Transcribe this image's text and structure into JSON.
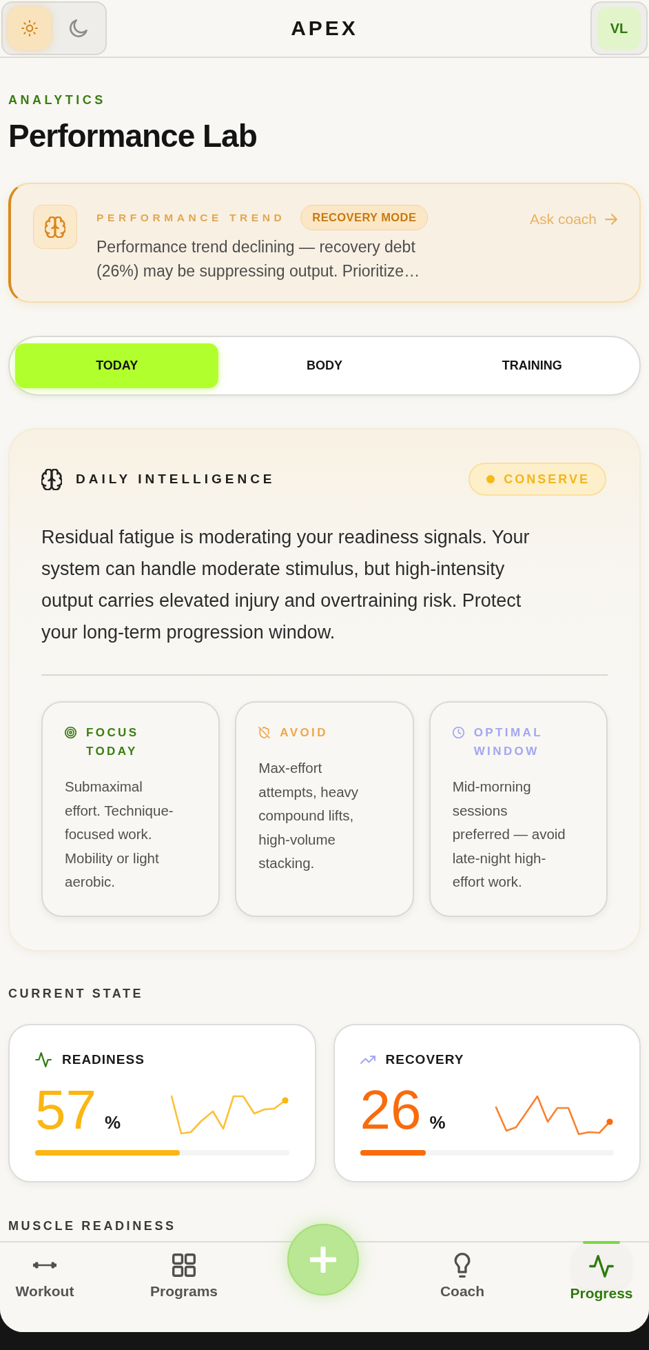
{
  "header": {
    "theme_options": [
      {
        "selected": true
      },
      {
        "selected": false
      }
    ],
    "title": "APEX",
    "avatar": "VL"
  },
  "page": {
    "eyebrow": "ANALYTICS",
    "title": "Performance Lab"
  },
  "trend_banner": {
    "label": "PERFORMANCE TREND",
    "badge": "RECOVERY MODE",
    "message": "Performance trend declining — recovery debt (26%) may be suppressing output. Prioritize…",
    "action": "Ask coach"
  },
  "tabs": [
    {
      "label": "TODAY",
      "selected": true
    },
    {
      "label": "BODY",
      "selected": false
    },
    {
      "label": "TRAINING",
      "selected": false
    }
  ],
  "daily_intelligence": {
    "title": "DAILY INTELLIGENCE",
    "status": "CONSERVE",
    "summary": "Residual fatigue is moderating your readiness signals. Your system can handle moderate stimulus, but high-intensity output carries elevated injury and overtraining risk. Protect your long-term progression window.",
    "insights": [
      {
        "title": "FOCUS TODAY",
        "color": "#3a7d10",
        "text": "Submaximal effort. Technique-focused work. Mobility or light aerobic."
      },
      {
        "title": "AVOID",
        "color": "#f0a64a",
        "text": "Max-effort attempts, heavy compound lifts, high-volume stacking."
      },
      {
        "title": "OPTIMAL WINDOW",
        "color": "#a3a6f2",
        "text": "Mid-morning sessions preferred — avoid late-night high-effort work."
      }
    ]
  },
  "current_state": {
    "heading": "CURRENT STATE",
    "metrics": [
      {
        "label": "READINESS",
        "value": "57",
        "unit": "%",
        "level": 0.57,
        "color": "#fbb614"
      },
      {
        "label": "RECOVERY",
        "value": "26",
        "unit": "%",
        "level": 0.26,
        "color": "#f96b0c"
      }
    ]
  },
  "muscle_readiness": {
    "heading": "MUSCLE READINESS"
  },
  "bottom_nav": {
    "items": [
      {
        "label": "Workout",
        "selected": false
      },
      {
        "label": "Programs",
        "selected": false
      },
      {
        "label": "Coach",
        "selected": false
      },
      {
        "label": "Progress",
        "selected": true
      }
    ]
  }
}
